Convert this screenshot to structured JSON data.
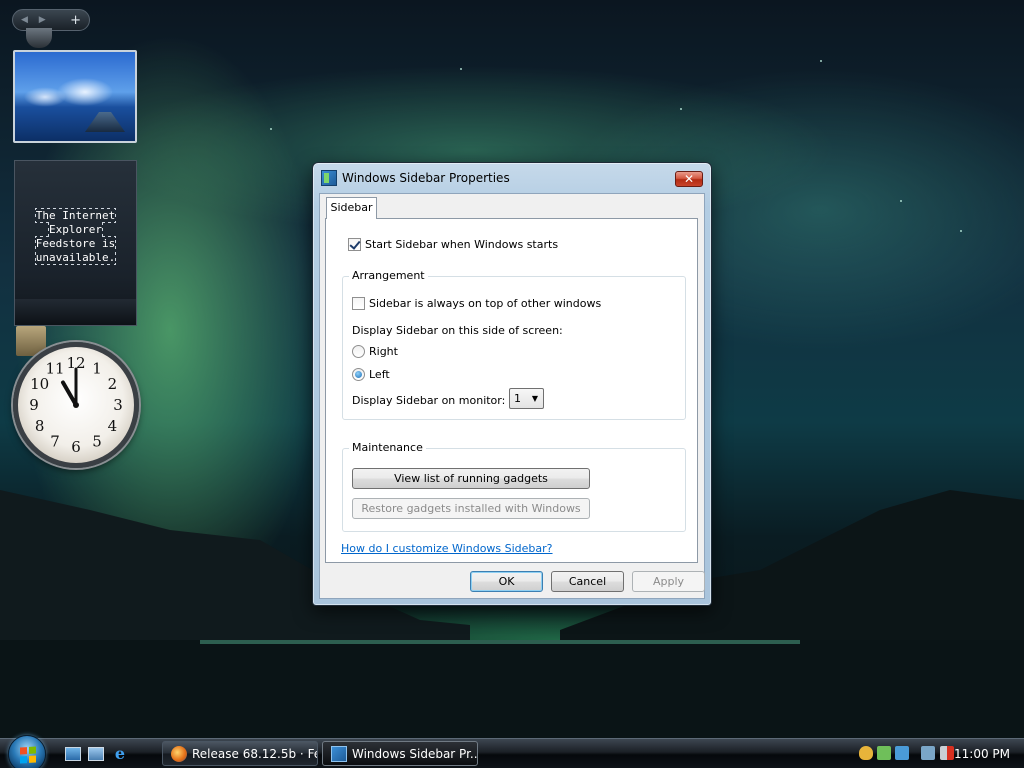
{
  "sidebar": {
    "add_label": "+",
    "feed_message": "The Internet Explorer Feedstore is unavailable."
  },
  "clock": {
    "numbers": [
      "12",
      "1",
      "2",
      "3",
      "4",
      "5",
      "6",
      "7",
      "8",
      "9",
      "10",
      "11"
    ],
    "hour": 11,
    "minute": 0
  },
  "dialog": {
    "title": "Windows Sidebar Properties",
    "close_label": "✕",
    "tab": "Sidebar",
    "start_sidebar": {
      "label": "Start Sidebar when Windows starts",
      "checked": true
    },
    "arrangement": {
      "title": "Arrangement",
      "always_on_top": {
        "label": "Sidebar is always on top of other windows",
        "checked": false
      },
      "side_label": "Display Sidebar on this side of screen:",
      "right_label": "Right",
      "left_label": "Left",
      "selected_side": "Left",
      "monitor_label": "Display Sidebar on monitor:",
      "monitor_value": "1"
    },
    "maintenance": {
      "title": "Maintenance",
      "view_button": "View list of running gadgets",
      "restore_button": "Restore gadgets installed with Windows"
    },
    "help_link": "How do I customize Windows Sidebar?",
    "ok_button": "OK",
    "cancel_button": "Cancel",
    "apply_button": "Apply"
  },
  "taskbar": {
    "items": [
      {
        "label": "Release 68.12.5b · Fe...",
        "icon": "firefox-icon",
        "active": false
      },
      {
        "label": "Windows Sidebar Pr...",
        "icon": "sidebar-icon",
        "active": true
      }
    ],
    "time": "11:00 PM"
  },
  "colors": {
    "link": "#0066cc",
    "aurora": "#6de07a",
    "close_button": "#c8442b"
  }
}
